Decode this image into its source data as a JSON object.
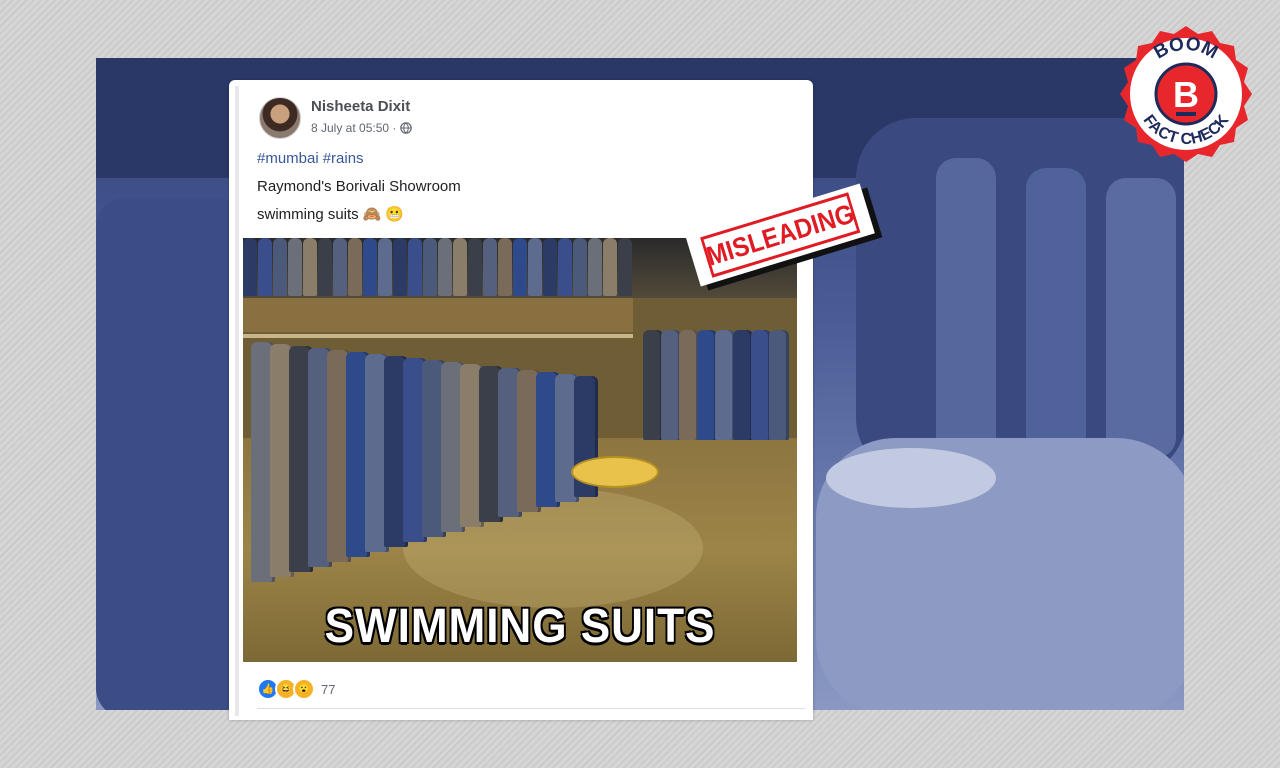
{
  "post": {
    "author": "Nisheeta Dixit",
    "timestamp": "8 July at 05:50 ·",
    "hashtags": [
      "#mumbai",
      "#rains"
    ],
    "line1": "Raymond's Borivali Showroom",
    "line2": "swimming suits",
    "line2_emojis": [
      "🙈",
      "😬"
    ],
    "image_overlay_text": "SWIMMING SUITS",
    "reaction_count": "77",
    "reaction_icons": [
      "like-icon",
      "haha-icon",
      "wow-icon"
    ]
  },
  "stamp": {
    "label": "MISLEADING",
    "color": "#e01b24"
  },
  "logo": {
    "top_text": "BOOM",
    "bottom_text": "FACT CHECK",
    "letter": "B",
    "color": "#e8272d",
    "navy": "#1e2a5a"
  },
  "icons": {
    "privacy": "globe-icon"
  },
  "colors": {
    "link": "#385898",
    "backdrop": "#4a5c94"
  }
}
